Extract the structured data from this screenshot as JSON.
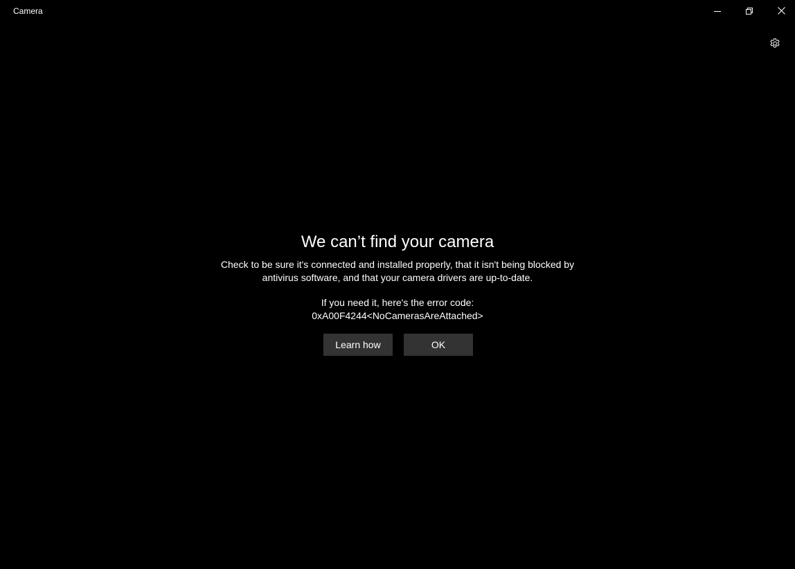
{
  "window": {
    "title": "Camera",
    "background": "#000000"
  },
  "caption_buttons": {
    "minimize_icon": "minimize-icon",
    "restore_icon": "restore-icon",
    "close_icon": "close-icon"
  },
  "settings": {
    "icon": "gear-icon"
  },
  "dialog": {
    "heading": "We can’t find your camera",
    "message": "Check to be sure it's connected and installed properly, that it isn't being blocked by antivirus software, and that your camera drivers are up-to-date.",
    "error_intro": "If you need it, here's the error code:",
    "error_code": "0xA00F4244<NoCamerasAreAttached>",
    "learn_button": "Learn how",
    "ok_button": "OK",
    "button_color": "#333333"
  }
}
